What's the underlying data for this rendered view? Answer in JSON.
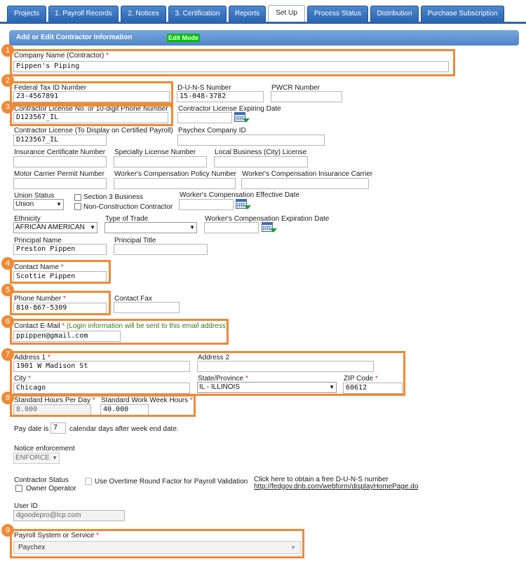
{
  "tabs": [
    {
      "label": "Projects"
    },
    {
      "label": "1. Payroll Records"
    },
    {
      "label": "2. Notices"
    },
    {
      "label": "3. Certification"
    },
    {
      "label": "Reports"
    },
    {
      "label": "Set Up"
    },
    {
      "label": "Process Status"
    },
    {
      "label": "Distribution"
    },
    {
      "label": "Purchase Subscription"
    }
  ],
  "header": {
    "title": "Add or Edit Contractor Information",
    "mode": "Edit Mode"
  },
  "badges": [
    "1",
    "2",
    "3",
    "4",
    "5",
    "6",
    "7",
    "8",
    "9"
  ],
  "form": {
    "company_name": {
      "label": "Company Name (Contractor)",
      "req": "*",
      "value": "Pippen's Piping"
    },
    "fed_tax": {
      "label": "Federal Tax ID Number",
      "value": "23-4567891"
    },
    "duns": {
      "label": "D-U-N-S Number",
      "value": "15-048-3782"
    },
    "pwcr": {
      "label": "PWCR Number",
      "value": ""
    },
    "license_no": {
      "label": "Contractor License No. or 10-digit Phone Number",
      "req": "*",
      "value": "D123567_IL"
    },
    "license_exp": {
      "label": "Contractor License Expiring Date",
      "value": ""
    },
    "license_display": {
      "label": "Contractor License (To Display on Certified Payroll)",
      "value": "D123567_IL"
    },
    "paychex_id": {
      "label": "Paychex Company ID",
      "value": ""
    },
    "insurance": {
      "label": "Insurance Certificate Number",
      "value": ""
    },
    "specialty": {
      "label": "Specialty License Number",
      "value": ""
    },
    "local_business": {
      "label": "Local Business (City) License",
      "value": ""
    },
    "motor_carrier": {
      "label": "Motor Carrier Permit Number",
      "value": ""
    },
    "wc_policy": {
      "label": "Worker's Compensation Policy Number",
      "value": ""
    },
    "wc_carrier": {
      "label": "Worker's Compensation Insurance Carrier",
      "value": ""
    },
    "union_status": {
      "label": "Union Status",
      "value": "Union"
    },
    "section3": {
      "label": "Section 3 Business"
    },
    "non_construction": {
      "label": "Non-Construction Contractor"
    },
    "wc_effective": {
      "label": "Worker's Compensation Effective Date",
      "value": ""
    },
    "ethnicity": {
      "label": "Ethnicity",
      "value": "AFRICAN AMERICAN"
    },
    "trade": {
      "label": "Type of Trade",
      "value": ""
    },
    "wc_expiration": {
      "label": "Worker's Compensation Expiration Date",
      "value": ""
    },
    "principal_name": {
      "label": "Principal Name",
      "value": "Preston Pippen"
    },
    "principal_title": {
      "label": "Principal Title",
      "value": ""
    },
    "contact_name": {
      "label": "Contact Name",
      "req": "*",
      "value": "Scottie Pippen"
    },
    "phone": {
      "label": "Phone Number",
      "req": "*",
      "value": "810-867-5309"
    },
    "fax": {
      "label": "Contact Fax",
      "value": ""
    },
    "email": {
      "label": "Contact E-Mail",
      "req": "*",
      "note": "(Login information will be sent to this email address)",
      "value": "ppippen@gmail.com"
    },
    "address1": {
      "label": "Address 1",
      "req": "*",
      "value": "1901 W Madison St"
    },
    "address2": {
      "label": "Address 2",
      "value": ""
    },
    "city": {
      "label": "City",
      "req": "*",
      "value": "Chicago"
    },
    "state": {
      "label": "State/Province",
      "req": "*",
      "value": "IL - ILLINOIS"
    },
    "zip": {
      "label": "ZIP Code",
      "req": "*",
      "value": "60612"
    },
    "hours_day": {
      "label": "Standard Hours Per Day",
      "req": "*",
      "value": "8.000"
    },
    "hours_week": {
      "label": "Standard Work Week Hours",
      "req": "*",
      "value": "40.000"
    },
    "pay_date": {
      "prefix": "Pay date is",
      "value": "7",
      "suffix": "calendar days after week end date."
    },
    "notice": {
      "label": "Notice enforcement",
      "value": "ENFORCE"
    },
    "contractor_status": {
      "label": "Contractor Status",
      "owner": "Owner Operator"
    },
    "overtime": {
      "label": "Use Overtime Round Factor for Payroll Validation"
    },
    "duns_link": {
      "text": "Click here to obtain a free D-U-N-S number",
      "url": "http://fedgov.dnb.com/webform/displayHomePage.do"
    },
    "user_id": {
      "label": "User ID",
      "value": "dgoodepro@lcp.com"
    },
    "payroll_system": {
      "label": "Payroll System or Service",
      "req": "*",
      "value": "Paychex"
    }
  }
}
